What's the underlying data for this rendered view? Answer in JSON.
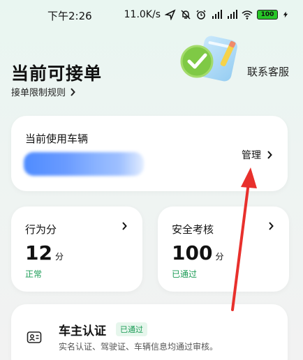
{
  "status_bar": {
    "time": "下午2:26",
    "net_speed": "11.0K/s",
    "battery": "100"
  },
  "header": {
    "title": "当前可接单",
    "rules_link": "接单限制规则",
    "contact": "联系客服"
  },
  "vehicle": {
    "title": "当前使用车辆",
    "manage": "管理"
  },
  "behavior": {
    "title": "行为分",
    "value": "12",
    "unit": "分",
    "status": "正常"
  },
  "safety": {
    "title": "安全考核",
    "value": "100",
    "unit": "分",
    "status": "已通过"
  },
  "owner": {
    "title": "车主认证",
    "badge": "已通过",
    "desc": "实名认证、驾驶证、车辆信息均通过审核。"
  },
  "colors": {
    "accent_green": "#1a9b55",
    "annotation_red": "#e8302c"
  }
}
